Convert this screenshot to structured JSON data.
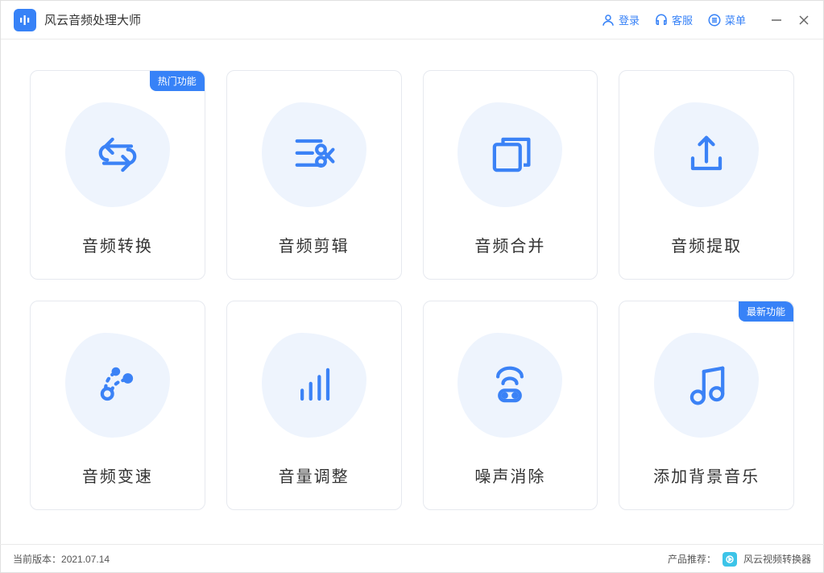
{
  "app": {
    "title": "风云音频处理大师"
  },
  "titlebar": {
    "login": "登录",
    "service": "客服",
    "menu": "菜单"
  },
  "cards": [
    {
      "label": "音频转换",
      "badge": "热门功能"
    },
    {
      "label": "音频剪辑"
    },
    {
      "label": "音频合并"
    },
    {
      "label": "音频提取"
    },
    {
      "label": "音频变速"
    },
    {
      "label": "音量调整"
    },
    {
      "label": "噪声消除"
    },
    {
      "label": "添加背景音乐",
      "badge": "最新功能"
    }
  ],
  "footer": {
    "version_label": "当前版本：",
    "version": "2021.07.14",
    "recommend_label": "产品推荐：",
    "recommend_app": "风云视频转换器"
  },
  "colors": {
    "accent": "#3782f7",
    "blob": "#eef4fd"
  }
}
